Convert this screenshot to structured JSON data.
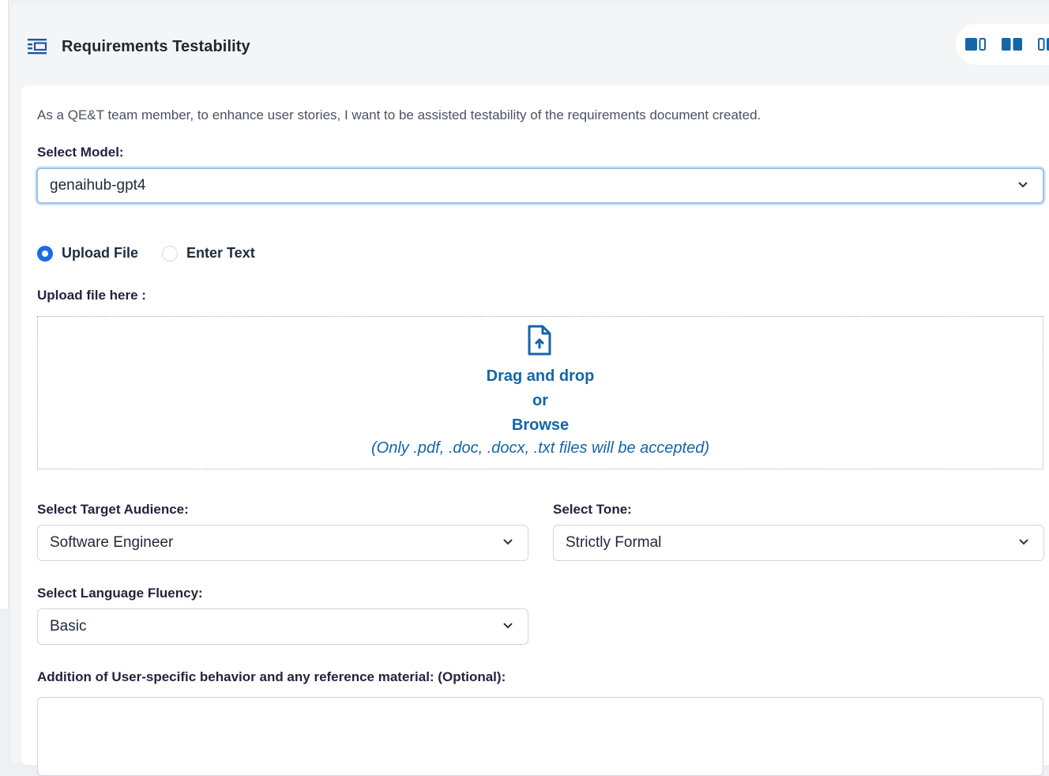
{
  "header": {
    "title": "Requirements Testability",
    "icon": "list-panel-icon"
  },
  "layout_toggle": {
    "icons": [
      "layout-wide-left-icon",
      "layout-split-icon",
      "layout-wide-right-icon"
    ]
  },
  "description": "As a QE&T team member, to enhance user stories, I want to be assisted testability of the requirements document created.",
  "model": {
    "label": "Select Model:",
    "value": "genaihub-gpt4"
  },
  "input_mode": {
    "options": [
      "Upload File",
      "Enter Text"
    ],
    "selected": "Upload File"
  },
  "upload": {
    "label": "Upload file here :",
    "drag_text": "Drag and drop",
    "or_text": "or",
    "browse_text": "Browse",
    "note": "(Only .pdf, .doc, .docx, .txt files will be accepted)"
  },
  "audience": {
    "label": "Select Target Audience:",
    "value": "Software Engineer"
  },
  "tone": {
    "label": "Select Tone:",
    "value": "Strictly Formal"
  },
  "fluency": {
    "label": "Select Language Fluency:",
    "value": "Basic"
  },
  "additional": {
    "label": "Addition of User-specific behavior and any reference material: (Optional):",
    "value": ""
  },
  "colors": {
    "accent": "#1a6ce6",
    "link": "#1466a8",
    "label": "#2a1f3d",
    "header_icon": "#1a5a9e"
  }
}
